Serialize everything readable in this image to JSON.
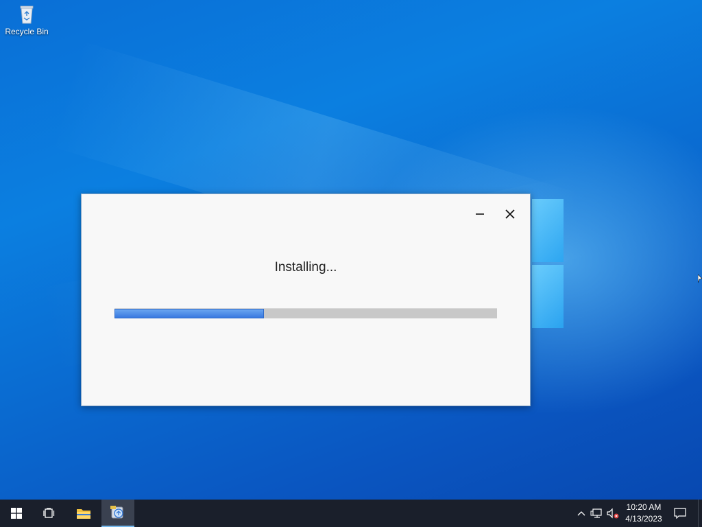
{
  "desktop": {
    "icons": [
      {
        "label": "Recycle Bin",
        "icon": "recycle-bin-icon"
      }
    ]
  },
  "installer": {
    "status_text": "Installing...",
    "progress_fraction": 0.39,
    "minimize_icon": "minimize-icon",
    "close_icon": "close-icon",
    "accent_color": "#3878e0"
  },
  "taskbar": {
    "buttons": [
      {
        "icon": "windows-start-icon"
      },
      {
        "icon": "task-view-icon"
      },
      {
        "icon": "file-explorer-icon"
      },
      {
        "icon": "installer-app-icon",
        "active": true
      }
    ],
    "tray": {
      "icons": [
        "chevron-up-icon",
        "network-icon",
        "volume-muted-icon"
      ],
      "time": "10:20 AM",
      "date": "4/13/2023",
      "notification_icon": "action-center-icon"
    }
  }
}
